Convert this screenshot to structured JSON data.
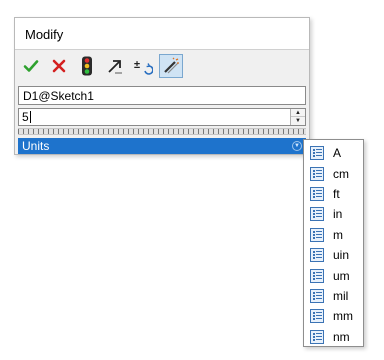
{
  "dialog": {
    "title": "Modify",
    "toolbar": [
      {
        "icon": "checkmark-icon",
        "name": "ok-button"
      },
      {
        "icon": "cross-icon",
        "name": "cancel-button"
      },
      {
        "icon": "traffic-light-icon",
        "name": "rebuild-button"
      },
      {
        "icon": "arrow-up-right-icon",
        "name": "regenerate-button"
      },
      {
        "icon": "plus-minus-icon",
        "name": "reverse-dimension-button"
      },
      {
        "icon": "wand-icon",
        "name": "mark-for-drawing-button",
        "pressed": true
      }
    ],
    "dimension_name": "D1@Sketch1",
    "value": "5",
    "units_label": "Units"
  },
  "units_menu": {
    "items": [
      "A",
      "cm",
      "ft",
      "in",
      "m",
      "uin",
      "um",
      "mil",
      "mm",
      "nm"
    ]
  },
  "colors": {
    "accent": "#1e73cc",
    "ok_green": "#2ea12e",
    "cancel_red": "#d42020"
  }
}
